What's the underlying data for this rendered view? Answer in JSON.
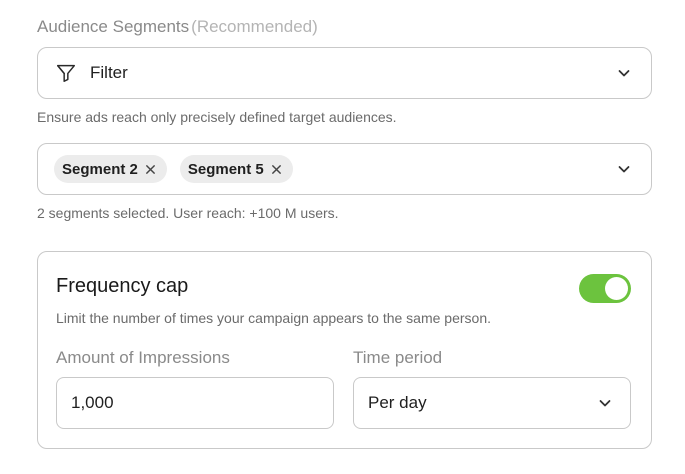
{
  "audience": {
    "title": "Audience Segments",
    "recommended": "(Recommended)",
    "filter": {
      "label": "Filter",
      "icon": "filter-icon"
    },
    "filter_helper": "Ensure ads reach only precisely defined target audiences.",
    "segments": [
      {
        "label": "Segment 2"
      },
      {
        "label": "Segment 5"
      }
    ],
    "segments_helper": "2 segments selected. User reach: +100 M users."
  },
  "frequency_cap": {
    "title": "Frequency cap",
    "description": "Limit the number of times your campaign appears to the same person.",
    "enabled": true,
    "toggle_color": "#6cc33e",
    "impressions": {
      "label": "Amount of Impressions",
      "value": "1,000"
    },
    "time_period": {
      "label": "Time period",
      "value": "Per day"
    }
  }
}
